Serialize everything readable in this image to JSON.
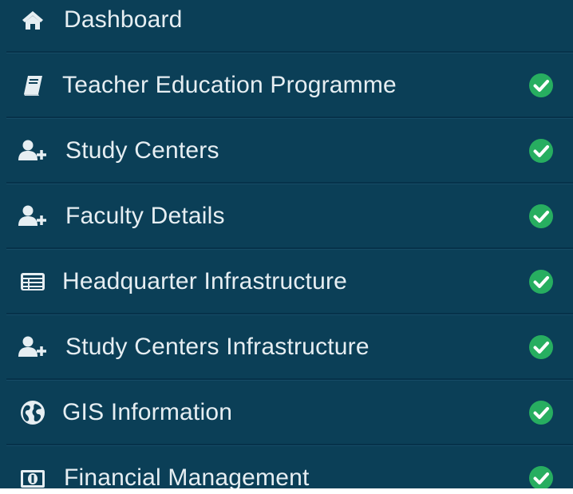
{
  "sidebar": {
    "items": [
      {
        "label": "Dashboard",
        "icon": "home-icon",
        "status": "none"
      },
      {
        "label": "Teacher Education Programme",
        "icon": "book-icon",
        "status": "complete"
      },
      {
        "label": "Study Centers",
        "icon": "add-user-icon",
        "status": "complete"
      },
      {
        "label": "Faculty Details",
        "icon": "add-user-icon",
        "status": "complete"
      },
      {
        "label": "Headquarter Infrastructure",
        "icon": "list-card-icon",
        "status": "complete"
      },
      {
        "label": "Study Centers Infrastructure",
        "icon": "add-user-icon",
        "status": "complete"
      },
      {
        "label": "GIS Information",
        "icon": "globe-icon",
        "status": "complete"
      },
      {
        "label": "Financial Management",
        "icon": "money-icon",
        "status": "complete"
      }
    ]
  },
  "colors": {
    "sidebar_bg": "#0b3f57",
    "text": "#e6eef2",
    "check_bg": "#27ae60",
    "divider": "#06324a"
  }
}
